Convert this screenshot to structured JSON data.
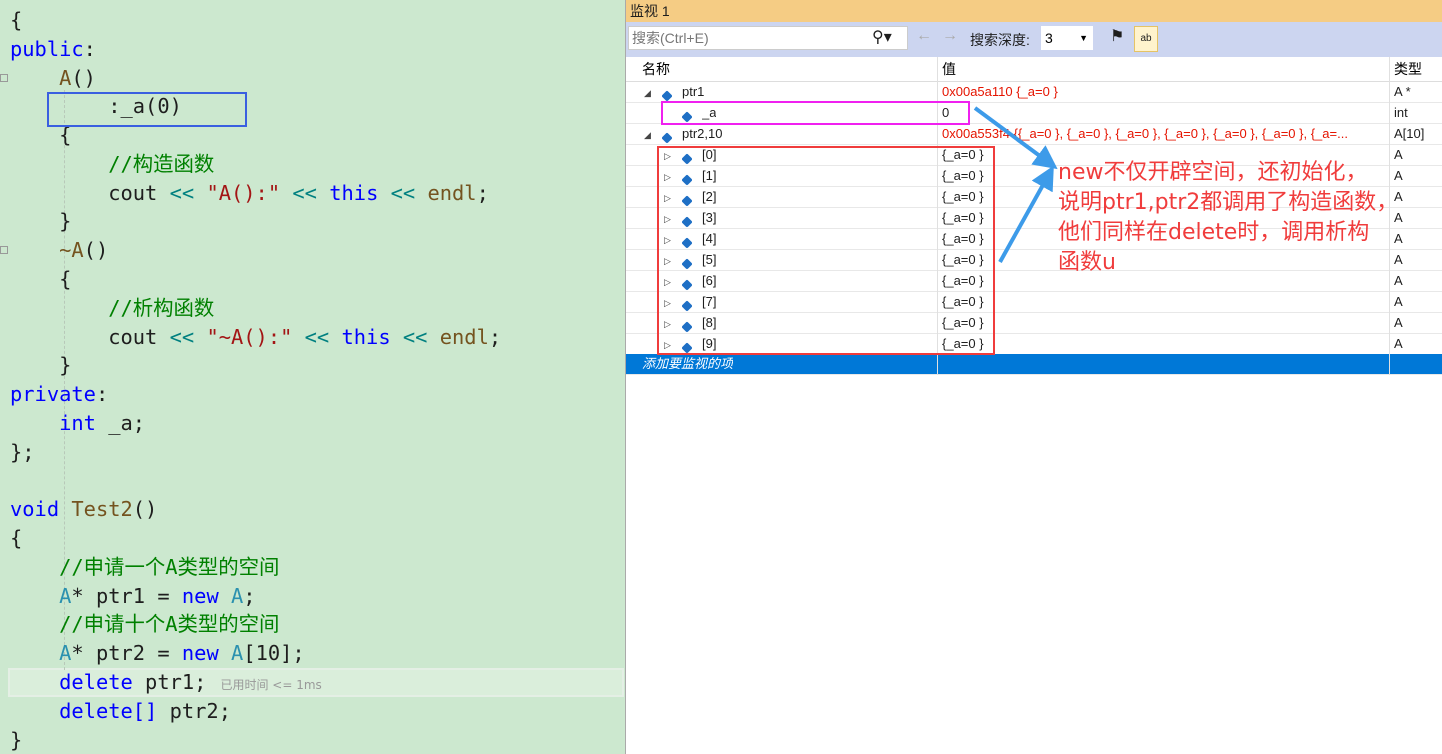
{
  "editor": {
    "lines": [
      [
        [
          "{",
          ""
        ]
      ],
      [
        [
          "public",
          "kw"
        ],
        [
          ":",
          ""
        ]
      ],
      [
        [
          "    A",
          "fn"
        ],
        [
          "()",
          ""
        ]
      ],
      [
        [
          "        :_a(0)",
          ""
        ]
      ],
      [
        [
          "    {",
          ""
        ]
      ],
      [
        [
          "        //构造函数",
          "cm"
        ]
      ],
      [
        [
          "        cout ",
          ""
        ],
        [
          "<<",
          "op"
        ],
        [
          " ",
          ""
        ],
        [
          "\"A():\"",
          "st"
        ],
        [
          " ",
          ""
        ],
        [
          "<<",
          "op"
        ],
        [
          " ",
          ""
        ],
        [
          "this",
          "kw"
        ],
        [
          " ",
          ""
        ],
        [
          "<<",
          "op"
        ],
        [
          " ",
          ""
        ],
        [
          "endl",
          "fn"
        ],
        [
          ";",
          ""
        ]
      ],
      [
        [
          "    }",
          ""
        ]
      ],
      [
        [
          "    ~A",
          "fn"
        ],
        [
          "()",
          ""
        ]
      ],
      [
        [
          "    {",
          ""
        ]
      ],
      [
        [
          "        //析构函数",
          "cm"
        ]
      ],
      [
        [
          "        cout ",
          ""
        ],
        [
          "<<",
          "op"
        ],
        [
          " ",
          ""
        ],
        [
          "\"~A():\"",
          "st"
        ],
        [
          " ",
          ""
        ],
        [
          "<<",
          "op"
        ],
        [
          " ",
          ""
        ],
        [
          "this",
          "kw"
        ],
        [
          " ",
          ""
        ],
        [
          "<<",
          "op"
        ],
        [
          " ",
          ""
        ],
        [
          "endl",
          "fn"
        ],
        [
          ";",
          ""
        ]
      ],
      [
        [
          "    }",
          ""
        ]
      ],
      [
        [
          "private",
          "kw"
        ],
        [
          ":",
          ""
        ]
      ],
      [
        [
          "    ",
          ""
        ],
        [
          "int",
          "kw"
        ],
        [
          " _a;",
          ""
        ]
      ],
      [
        [
          "};",
          ""
        ]
      ],
      [
        [
          "",
          ""
        ]
      ],
      [
        [
          "void",
          "kw"
        ],
        [
          " ",
          ""
        ],
        [
          "Test2",
          "fn"
        ],
        [
          "()",
          ""
        ]
      ],
      [
        [
          "{",
          ""
        ]
      ],
      [
        [
          "    //申请一个A类型的空间",
          "cm"
        ]
      ],
      [
        [
          "    ",
          ""
        ],
        [
          "A",
          "ty"
        ],
        [
          "* ptr1 = ",
          ""
        ],
        [
          "new",
          "kw"
        ],
        [
          " ",
          ""
        ],
        [
          "A",
          "ty"
        ],
        [
          ";",
          ""
        ]
      ],
      [
        [
          "    //申请十个A类型的空间",
          "cm"
        ]
      ],
      [
        [
          "    ",
          ""
        ],
        [
          "A",
          "ty"
        ],
        [
          "* ptr2 = ",
          ""
        ],
        [
          "new",
          "kw"
        ],
        [
          " ",
          ""
        ],
        [
          "A",
          "ty"
        ],
        [
          "[10];",
          ""
        ]
      ],
      [
        [
          "    ",
          ""
        ],
        [
          "delete",
          "kw"
        ],
        [
          " ptr1;",
          ""
        ]
      ],
      [
        [
          "    ",
          ""
        ],
        [
          "delete[]",
          "kw"
        ],
        [
          " ptr2;",
          ""
        ]
      ],
      [
        [
          "}",
          ""
        ]
      ]
    ],
    "perf_hint": "已用时间 <= 1ms"
  },
  "watch": {
    "title": "监视 1",
    "search_placeholder": "搜索(Ctrl+E)",
    "depth_label": "搜索深度:",
    "depth_value": "3",
    "columns": {
      "name": "名称",
      "value": "值",
      "type": "类型"
    },
    "rows": [
      {
        "name": "ptr1",
        "value": "0x00a5a110 {_a=0 }",
        "type": "A *",
        "level": 0,
        "expander": "expanded",
        "red": true
      },
      {
        "name": "_a",
        "value": "0",
        "type": "int",
        "level": 1,
        "expander": "",
        "red": false
      },
      {
        "name": "ptr2,10",
        "value": "0x00a553f4 {{_a=0 }, {_a=0 }, {_a=0 }, {_a=0 }, {_a=0 }, {_a=0 }, {_a=...",
        "type": "A[10]",
        "level": 0,
        "expander": "expanded",
        "red": true
      },
      {
        "name": "[0]",
        "value": "{_a=0 }",
        "type": "A",
        "level": 1,
        "expander": "collapsed",
        "red": false
      },
      {
        "name": "[1]",
        "value": "{_a=0 }",
        "type": "A",
        "level": 1,
        "expander": "collapsed",
        "red": false
      },
      {
        "name": "[2]",
        "value": "{_a=0 }",
        "type": "A",
        "level": 1,
        "expander": "collapsed",
        "red": false
      },
      {
        "name": "[3]",
        "value": "{_a=0 }",
        "type": "A",
        "level": 1,
        "expander": "collapsed",
        "red": false
      },
      {
        "name": "[4]",
        "value": "{_a=0 }",
        "type": "A",
        "level": 1,
        "expander": "collapsed",
        "red": false
      },
      {
        "name": "[5]",
        "value": "{_a=0 }",
        "type": "A",
        "level": 1,
        "expander": "collapsed",
        "red": false
      },
      {
        "name": "[6]",
        "value": "{_a=0 }",
        "type": "A",
        "level": 1,
        "expander": "collapsed",
        "red": false
      },
      {
        "name": "[7]",
        "value": "{_a=0 }",
        "type": "A",
        "level": 1,
        "expander": "collapsed",
        "red": false
      },
      {
        "name": "[8]",
        "value": "{_a=0 }",
        "type": "A",
        "level": 1,
        "expander": "collapsed",
        "red": false
      },
      {
        "name": "[9]",
        "value": "{_a=0 }",
        "type": "A",
        "level": 1,
        "expander": "collapsed",
        "red": false
      }
    ],
    "add_item": "添加要监视的项"
  },
  "annotation": {
    "text": "new不仅开辟空间，还初始化，\n说明ptr1,ptr2都调用了构造函数，\n他们同样在delete时，调用析构\n函数u",
    "colors": {
      "blue_box": "#3a5fe0",
      "magenta_box": "#f020f0",
      "red_box": "#f03c3c",
      "arrow": "#3d9be9"
    }
  }
}
